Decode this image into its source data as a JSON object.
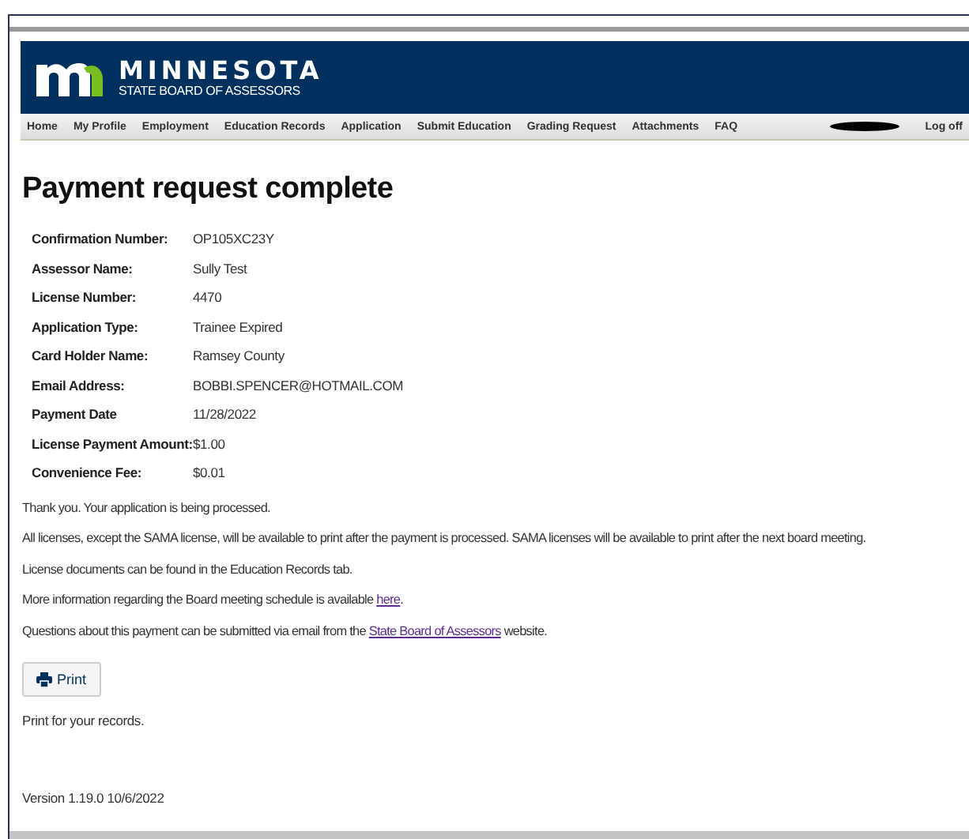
{
  "header": {
    "logo_title": "MINNESOTA",
    "logo_subtitle": "STATE BOARD OF ASSESSORS"
  },
  "nav": {
    "items": [
      {
        "label": "Home"
      },
      {
        "label": "My Profile"
      },
      {
        "label": "Employment"
      },
      {
        "label": "Education Records"
      },
      {
        "label": "Application"
      },
      {
        "label": "Submit Education"
      },
      {
        "label": "Grading Request"
      },
      {
        "label": "Attachments"
      },
      {
        "label": "FAQ"
      }
    ],
    "logoff": "Log off"
  },
  "title": "Payment request complete",
  "details": [
    {
      "label": "Confirmation Number:",
      "value": "OP105XC23Y"
    },
    {
      "label": "Assessor Name:",
      "value": "Sully Test"
    },
    {
      "label": "License Number:",
      "value": "4470"
    },
    {
      "label": "Application Type:",
      "value": "Trainee Expired"
    },
    {
      "label": "Card Holder Name:",
      "value": "Ramsey County"
    },
    {
      "label": "Email Address:",
      "value": "BOBBI.SPENCER@HOTMAIL.COM"
    },
    {
      "label": "Payment Date",
      "value": "11/28/2022"
    },
    {
      "label": "License Payment Amount:",
      "value": "$1.00"
    },
    {
      "label": "Convenience Fee:",
      "value": "$0.01"
    }
  ],
  "messages": [
    {
      "text": "Thank you. Your application is being processed."
    },
    {
      "text": "All licenses, except the SAMA license, will be available to print after the payment is processed. SAMA licenses will be available to print after the next board meeting."
    },
    {
      "text": "License documents can be found in the Education Records tab."
    },
    {
      "text": "More information regarding the Board meeting schedule is available ",
      "link": "here",
      "after": "."
    },
    {
      "text": "Questions about this payment can be submitted via email from the ",
      "link": "State Board of Assessors",
      "after": " website."
    }
  ],
  "print_button": "Print",
  "print_note": "Print for your records.",
  "version": "Version 1.19.0 10/6/2022"
}
